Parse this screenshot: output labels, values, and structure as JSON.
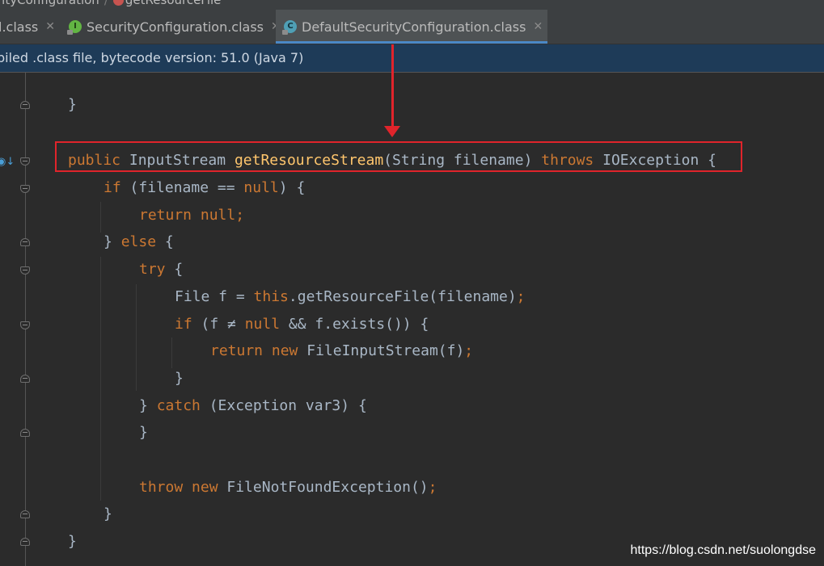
{
  "breadcrumb": {
    "items": [
      "rityConfiguration",
      "getResourceFile"
    ]
  },
  "tabs": [
    {
      "label": "l.class",
      "icon": "none"
    },
    {
      "label": "SecurityConfiguration.class",
      "icon": "interface-icon"
    },
    {
      "label": "DefaultSecurityConfiguration.class",
      "icon": "class-icon",
      "active": true
    }
  ],
  "tab_close_glyph": "✕",
  "banner": {
    "text": "piled .class file, bytecode version: 51.0 (Java 7)"
  },
  "code": {
    "l1_brace": "}",
    "l2_public": "public",
    "l2_type": "InputStream",
    "l2_method": "getResourceStream",
    "l2_params": "(String filename)",
    "l2_throws": "throws",
    "l2_exc": "IOException {",
    "l3_if": "if",
    "l3_cond": "(filename == ",
    "l3_null": "null",
    "l3_end": ") {",
    "l4_return": "return",
    "l4_null": "null",
    "l4_semi": ";",
    "l5_close": "} ",
    "l5_else": "else",
    "l5_open": " {",
    "l6_try": "try",
    "l6_open": " {",
    "l7_decl": "File f = ",
    "l7_this": "this",
    "l7_call": ".getResourceFile(filename)",
    "l7_semi": ";",
    "l8_if": "if",
    "l8_cond": " (f ≠ ",
    "l8_null": "null",
    "l8_rest": " && f.exists()) {",
    "l9_return": "return",
    "l9_new": "new",
    "l9_call": " FileInputStream(f)",
    "l9_semi": ";",
    "l10_close": "}",
    "l11_close": "} ",
    "l11_catch": "catch",
    "l11_rest": " (Exception var3) {",
    "l12_close": "}",
    "l14_throw": "throw",
    "l14_new": "new",
    "l14_call": " FileNotFoundException()",
    "l14_semi": ";",
    "l15_close": "}",
    "l16_close": "}"
  },
  "watermark": "https://blog.csdn.net/suolongdse",
  "colors": {
    "keyword": "#cc7832",
    "method": "#ffc66d",
    "text": "#a9b7c6",
    "highlight": "#e0242b",
    "banner": "#1e3b58"
  }
}
